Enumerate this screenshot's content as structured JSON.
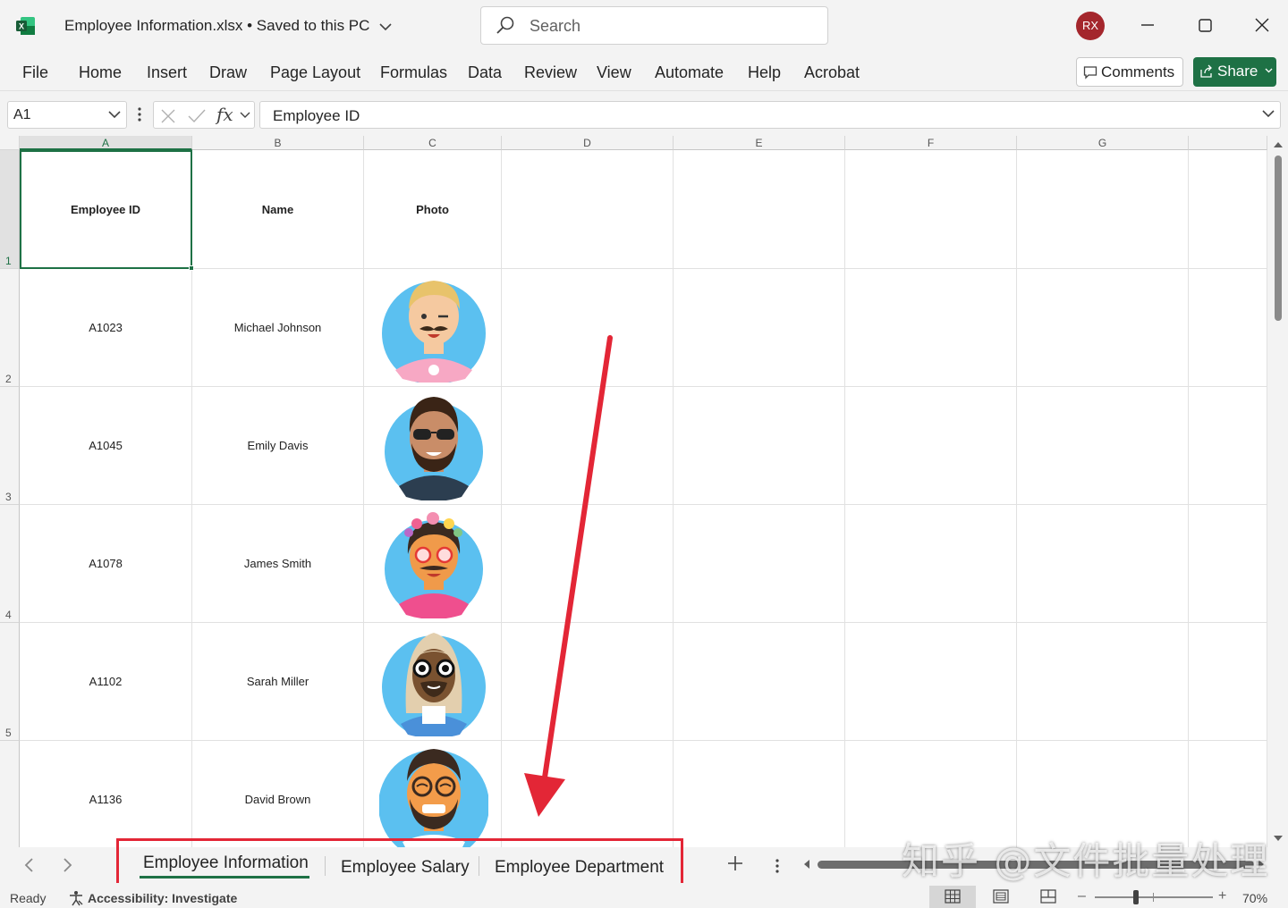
{
  "titlebar": {
    "doc_name": "Employee Information.xlsx",
    "separator": "•",
    "save_status": "Saved to this PC",
    "search_placeholder": "Search",
    "user_initials": "RX"
  },
  "menu": [
    "File",
    "Home",
    "Insert",
    "Draw",
    "Page Layout",
    "Formulas",
    "Data",
    "Review",
    "View",
    "Automate",
    "Help",
    "Acrobat"
  ],
  "actions": {
    "comments": "Comments",
    "share": "Share"
  },
  "formula_bar": {
    "name_box": "A1",
    "fx": "fx",
    "content": "Employee ID"
  },
  "columns": [
    "A",
    "B",
    "C",
    "D",
    "E",
    "F",
    "G"
  ],
  "rows": [
    "1",
    "2",
    "3",
    "4",
    "5"
  ],
  "table": {
    "headers": [
      "Employee ID",
      "Name",
      "Photo"
    ],
    "records": [
      {
        "id": "A1023",
        "name": "Michael Johnson"
      },
      {
        "id": "A1045",
        "name": "Emily Davis"
      },
      {
        "id": "A1078",
        "name": "James Smith"
      },
      {
        "id": "A1102",
        "name": "Sarah Miller"
      },
      {
        "id": "A1136",
        "name": "David Brown"
      }
    ]
  },
  "sheets": [
    {
      "name": "Employee Information",
      "active": true
    },
    {
      "name": "Employee Salary",
      "active": false
    },
    {
      "name": "Employee Department",
      "active": false
    }
  ],
  "watermark": "知乎 @文件批量处理",
  "status": {
    "ready": "Ready",
    "accessibility": "Accessibility: Investigate",
    "zoom": "70%",
    "zoom_level_fraction": 0.35
  },
  "colors": {
    "accent": "#1e7145",
    "annotation_red": "#e32636",
    "avatar_bg": "#a4262c",
    "photo_bg": "#5bc0f0"
  }
}
